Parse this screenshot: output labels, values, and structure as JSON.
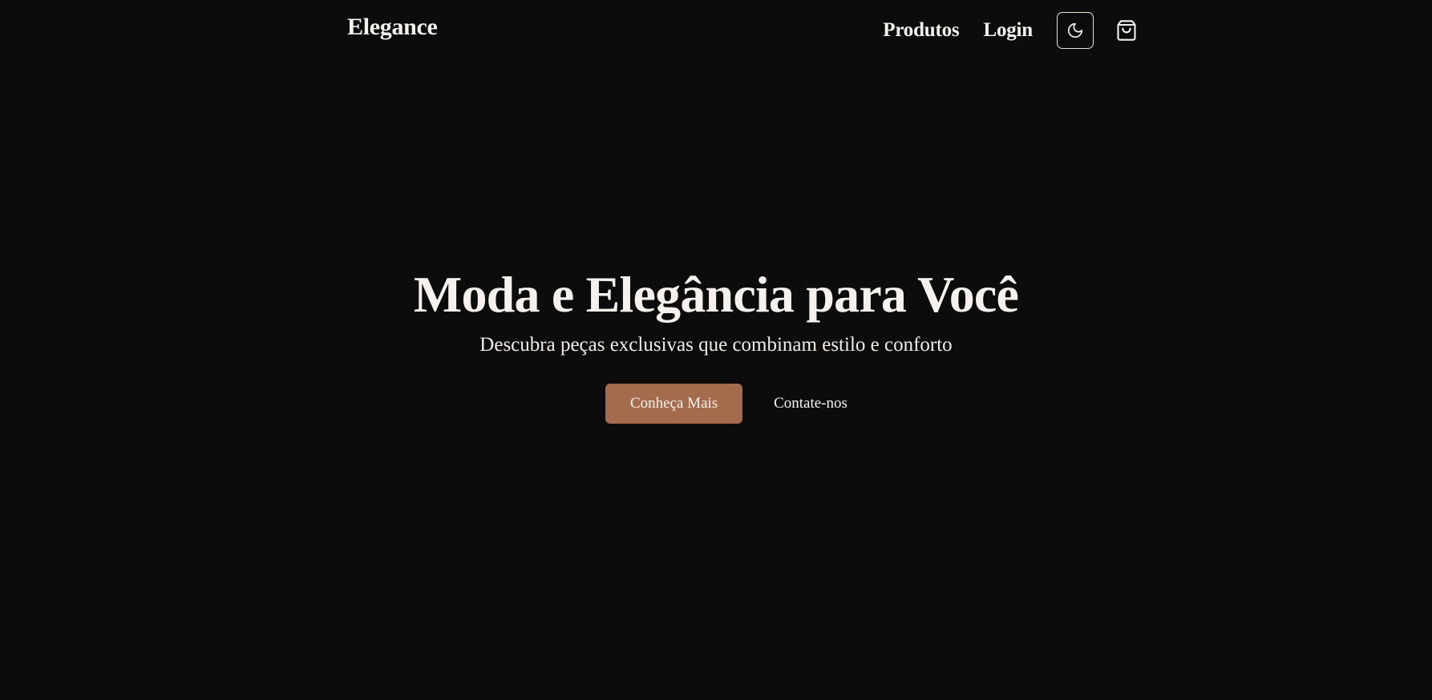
{
  "header": {
    "brand": "Elegance",
    "nav": {
      "products": "Produtos",
      "login": "Login"
    },
    "icons": {
      "theme_toggle": "moon-icon",
      "cart": "shopping-bag-icon"
    }
  },
  "hero": {
    "title": "Moda e Elegância para Você",
    "subtitle": "Descubra peças exclusivas que combinam estilo e conforto",
    "primary_button": "Conheça Mais",
    "secondary_button": "Contate-nos"
  },
  "colors": {
    "background": "#0d0c0d",
    "text": "#f5f2ee",
    "accent": "#a56b4d"
  }
}
